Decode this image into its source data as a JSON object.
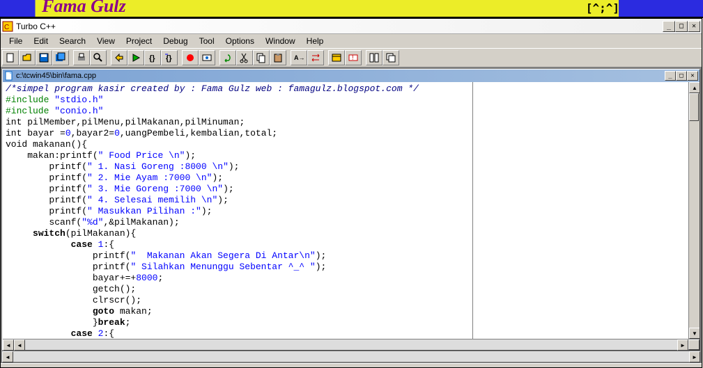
{
  "banner": {
    "script_text": "Fama Gulz",
    "emoticon": "[^;^]"
  },
  "app": {
    "title": "Turbo C++",
    "menus": [
      "File",
      "Edit",
      "Search",
      "View",
      "Project",
      "Debug",
      "Tool",
      "Options",
      "Window",
      "Help"
    ]
  },
  "toolbar_icons": [
    "new-file-icon",
    "open-file-icon",
    "save-file-icon",
    "save-all-icon",
    "sep",
    "print-icon",
    "find-icon",
    "sep",
    "compile-icon",
    "run-icon",
    "trace-into-icon",
    "step-over-icon",
    "sep",
    "toggle-breakpoint-icon",
    "add-watch-icon",
    "sep",
    "undo-icon",
    "cut-icon",
    "copy-icon",
    "paste-icon",
    "sep",
    "find-text-icon",
    "replace-icon",
    "sep",
    "project-icon",
    "message-icon",
    "sep",
    "window-tile-icon",
    "window-cascade-icon"
  ],
  "document": {
    "path": "c:\\tcwin45\\bin\\fama.cpp"
  },
  "code_lines": [
    {
      "t": "comment",
      "s": "/*simpel program kasir created by : Fama Gulz web : famagulz.blogspot.com */"
    },
    {
      "t": "pp",
      "s": "#include ",
      "str": "\"stdio.h\""
    },
    {
      "t": "pp",
      "s": "#include ",
      "str": "\"conio.h\""
    },
    {
      "t": "plain",
      "s": "int pilMember,pilMenu,pilMakanan,pilMinuman;"
    },
    {
      "t": "mixed",
      "pre": "int bayar =",
      "n1": "0",
      "mid": ",bayar2=",
      "n2": "0",
      "post": ",uangPembeli,kembalian,total;"
    },
    {
      "t": "plain",
      "s": "void makanan(){"
    },
    {
      "t": "printf",
      "indent": "    ",
      "pre": "makan:printf(",
      "str": "\" Food Price \\n\"",
      "post": ");"
    },
    {
      "t": "printf",
      "indent": "        ",
      "pre": "printf(",
      "str": "\" 1. Nasi Goreng :8000 \\n\"",
      "post": ");"
    },
    {
      "t": "printf",
      "indent": "        ",
      "pre": "printf(",
      "str": "\" 2. Mie Ayam :7000 \\n\"",
      "post": ");"
    },
    {
      "t": "printf",
      "indent": "        ",
      "pre": "printf(",
      "str": "\" 3. Mie Goreng :7000 \\n\"",
      "post": ");"
    },
    {
      "t": "printf",
      "indent": "        ",
      "pre": "printf(",
      "str": "\" 4. Selesai memilih \\n\"",
      "post": ");"
    },
    {
      "t": "printf",
      "indent": "        ",
      "pre": "printf(",
      "str": "\" Masukkan Pilihan :\"",
      "post": ");"
    },
    {
      "t": "printf",
      "indent": "        ",
      "pre": "scanf(",
      "str": "\"%d\"",
      "post": ",&pilMakanan);"
    },
    {
      "t": "kw",
      "indent": "     ",
      "kw": "switch",
      "post": "(pilMakanan){"
    },
    {
      "t": "kw",
      "indent": "            ",
      "kw": "case",
      "post": " ",
      "n": "1",
      "tail": ":{"
    },
    {
      "t": "printf",
      "indent": "                ",
      "pre": "printf(",
      "str": "\"  Makanan Akan Segera Di Antar\\n\"",
      "post": ");"
    },
    {
      "t": "printf",
      "indent": "                ",
      "pre": "printf(",
      "str": "\" Silahkan Menunggu Sebentar ^_^ \"",
      "post": ");"
    },
    {
      "t": "mixed",
      "indent": "                ",
      "pre": "bayar+=+",
      "n1": "8000",
      "post": ";"
    },
    {
      "t": "plain",
      "indent": "                ",
      "s": "getch();"
    },
    {
      "t": "plain",
      "indent": "                ",
      "s": "clrscr();"
    },
    {
      "t": "kw",
      "indent": "                ",
      "kw": "goto",
      "post": " makan;"
    },
    {
      "t": "kw",
      "indent": "                ",
      "pre": "}",
      "kw": "break",
      "post": ";"
    },
    {
      "t": "kw",
      "indent": "            ",
      "kw": "case",
      "post": " ",
      "n": "2",
      "tail": ":{"
    }
  ],
  "win_controls": {
    "min": "_",
    "max": "□",
    "close": "✕"
  }
}
